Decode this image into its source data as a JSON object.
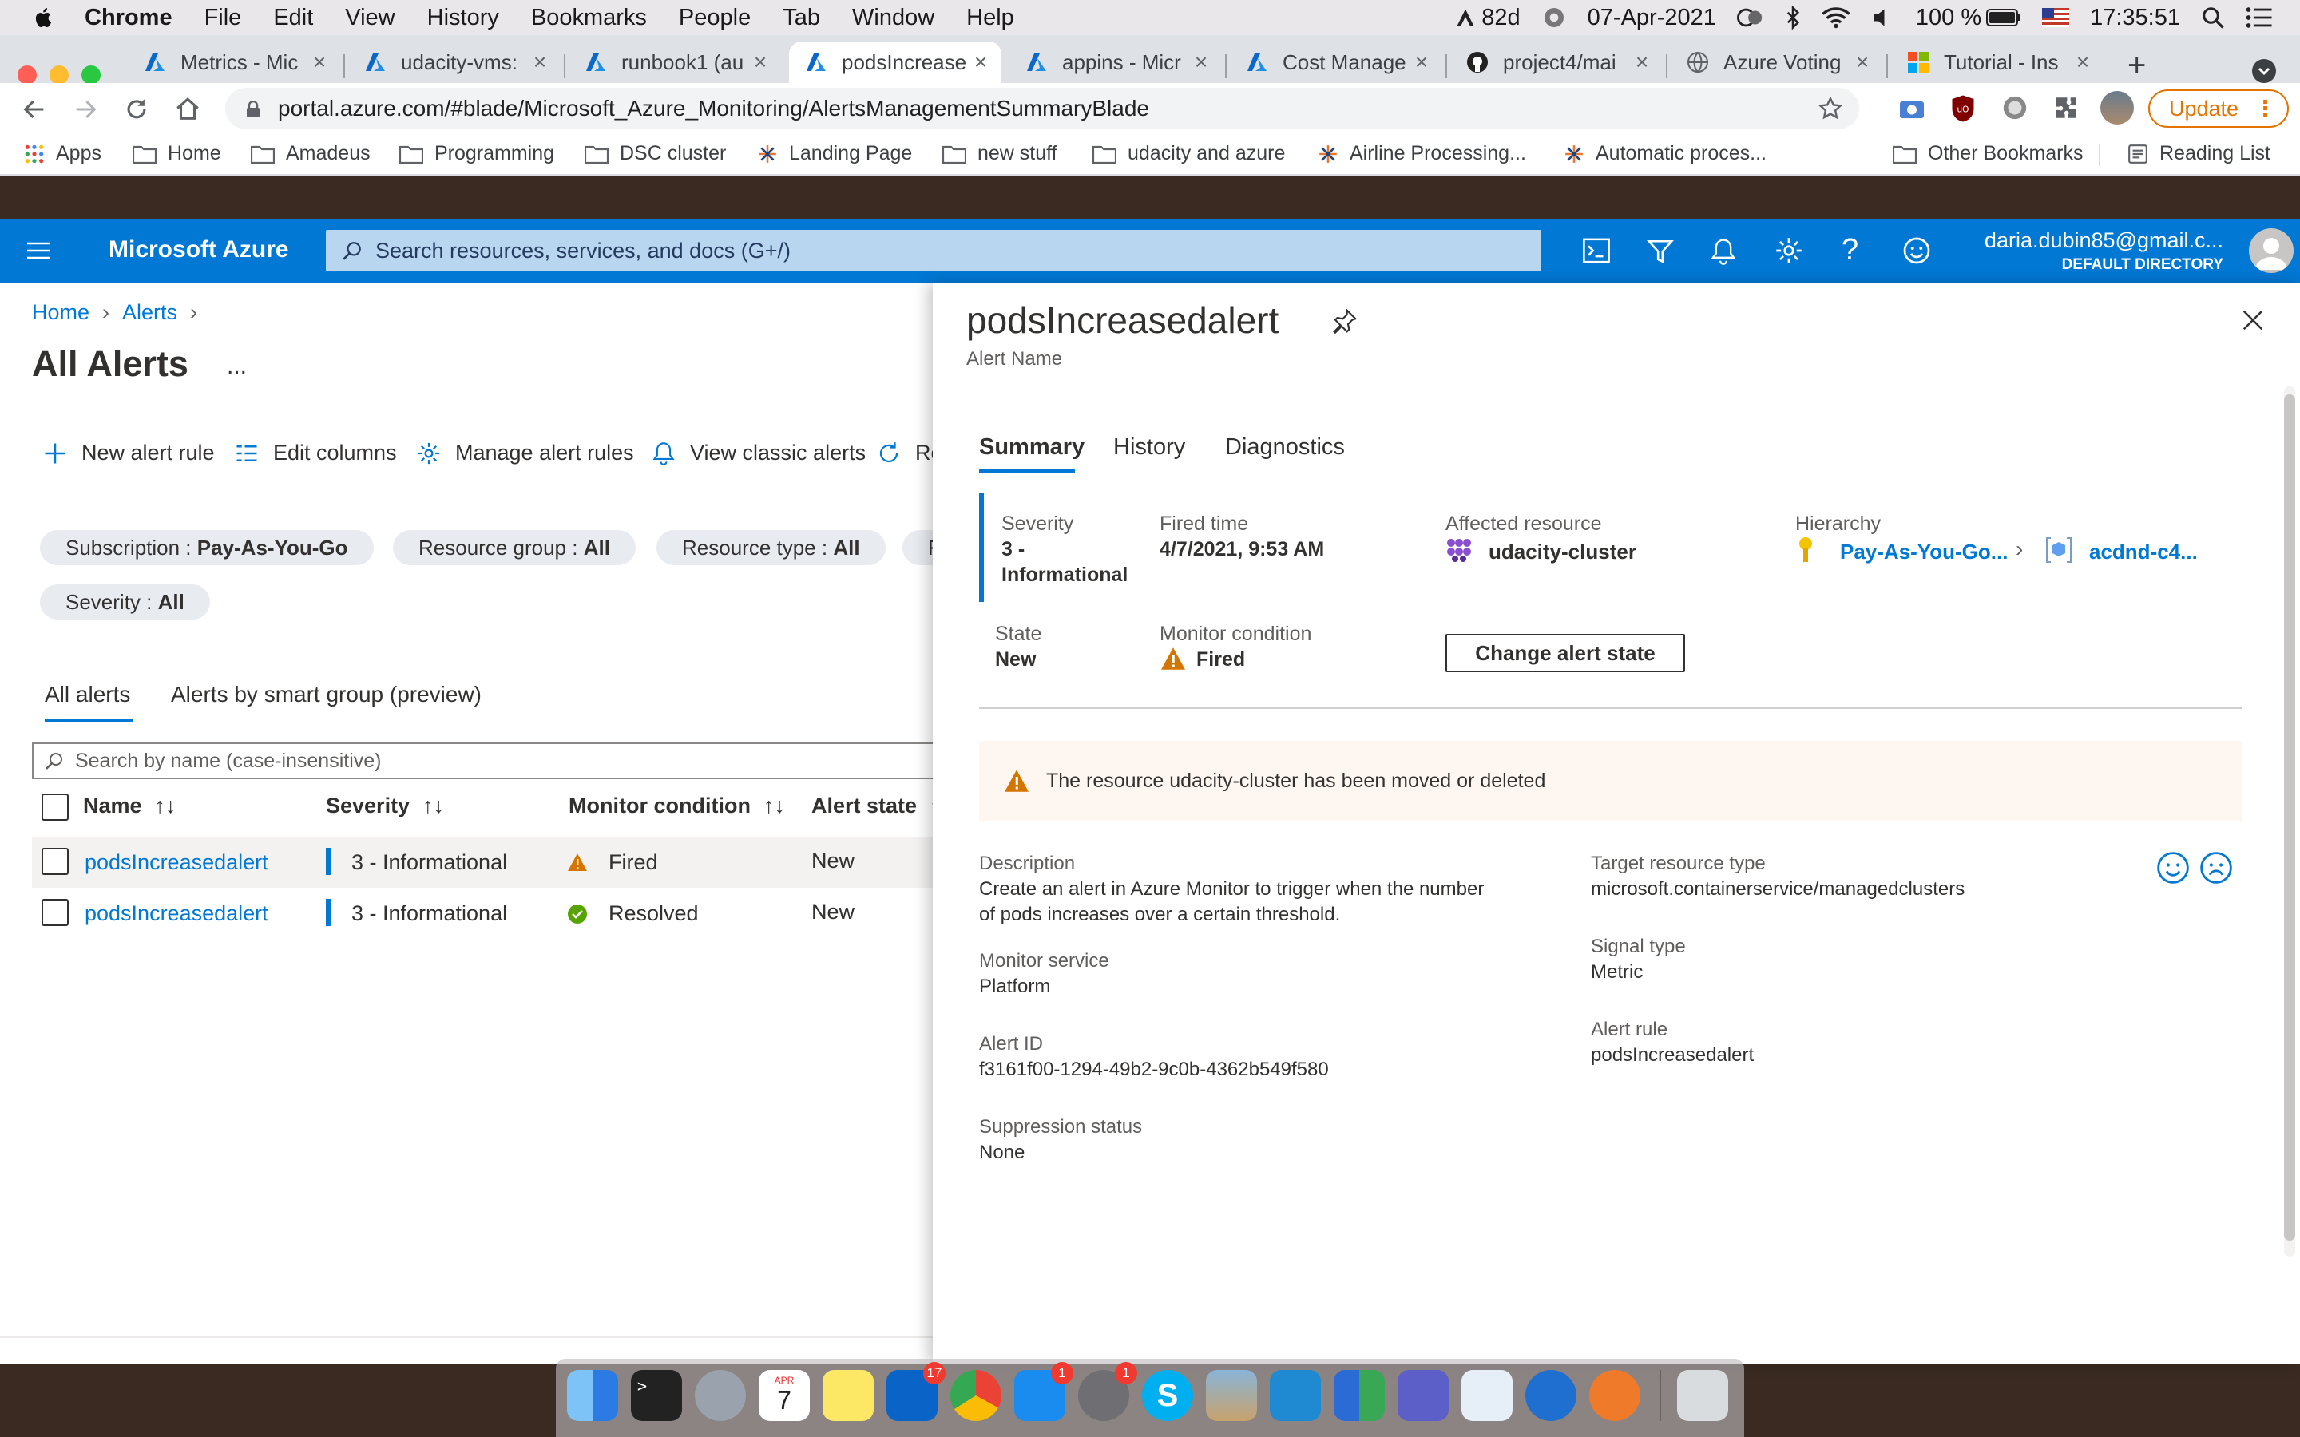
{
  "mac_menu": {
    "app": "Chrome",
    "items": [
      "File",
      "Edit",
      "View",
      "History",
      "Bookmarks",
      "People",
      "Tab",
      "Window",
      "Help"
    ],
    "status": {
      "vpn": "82d",
      "date": "07-Apr-2021",
      "battery": "100 %",
      "time": "17:35:51"
    }
  },
  "tabs": [
    {
      "title": "Metrics - Mic",
      "icon": "azure-icon"
    },
    {
      "title": "udacity-vms:",
      "icon": "azure-icon"
    },
    {
      "title": "runbook1 (au",
      "icon": "azure-icon"
    },
    {
      "title": "podsIncrease",
      "icon": "azure-icon",
      "active": true
    },
    {
      "title": "appins - Micr",
      "icon": "azure-icon"
    },
    {
      "title": "Cost Manage",
      "icon": "azure-icon"
    },
    {
      "title": "project4/mai",
      "icon": "github-icon"
    },
    {
      "title": "Azure Voting",
      "icon": "globe-icon"
    },
    {
      "title": "Tutorial - Ins",
      "icon": "microsoft-icon"
    }
  ],
  "address": {
    "url": "portal.azure.com/#blade/Microsoft_Azure_Monitoring/AlertsManagementSummaryBlade",
    "update_label": "Update"
  },
  "bookmarks": [
    {
      "label": "Apps"
    },
    {
      "label": "Home"
    },
    {
      "label": "Amadeus"
    },
    {
      "label": "Programming"
    },
    {
      "label": "DSC cluster"
    },
    {
      "label": "Landing Page"
    },
    {
      "label": "new stuff"
    },
    {
      "label": "udacity and azure"
    },
    {
      "label": "Airline Processing..."
    },
    {
      "label": "Automatic proces..."
    },
    {
      "label": "Other Bookmarks"
    },
    {
      "label": "Reading List"
    }
  ],
  "azure": {
    "brand": "Microsoft Azure",
    "search_placeholder": "Search resources, services, and docs (G+/)",
    "user_email": "daria.dubin85@gmail.c...",
    "directory": "DEFAULT DIRECTORY"
  },
  "breadcrumb": [
    "Home",
    "Alerts"
  ],
  "page_title": "All Alerts",
  "more": "...",
  "commands": [
    "New alert rule",
    "Edit columns",
    "Manage alert rules",
    "View classic alerts",
    "Re"
  ],
  "filters": {
    "subscription": {
      "label": "Subscription : ",
      "value": "Pay-As-You-Go"
    },
    "resource_group": {
      "label": "Resource group : ",
      "value": "All"
    },
    "resource_type": {
      "label": "Resource type : ",
      "value": "All"
    },
    "cut": "F",
    "severity": {
      "label": "Severity : ",
      "value": "All"
    }
  },
  "view_tabs": [
    "All alerts",
    "Alerts by smart group (preview)"
  ],
  "grid_search_placeholder": "Search by name (case-insensitive)",
  "grid_headers": [
    "Name",
    "Severity",
    "Monitor condition",
    "Alert state"
  ],
  "rows": [
    {
      "name": "podsIncreasedalert",
      "severity": "3 - Informational",
      "condition": "Fired",
      "state": "New"
    },
    {
      "name": "podsIncreasedalert",
      "severity": "3 - Informational",
      "condition": "Resolved",
      "state": "New"
    }
  ],
  "blade": {
    "title": "podsIncreasedalert",
    "subtitle": "Alert Name",
    "tabs": [
      "Summary",
      "History",
      "Diagnostics"
    ],
    "severity_label": "Severity",
    "severity_l1": "3 -",
    "severity_l2": "Informational",
    "fired_label": "Fired time",
    "fired_value": "4/7/2021, 9:53 AM",
    "resource_label": "Affected resource",
    "resource_value": "udacity-cluster",
    "hierarchy_label": "Hierarchy",
    "hierarchy_1": "Pay-As-You-Go...",
    "hierarchy_2": "acdnd-c4...",
    "state_label": "State",
    "state_value": "New",
    "monitor_label": "Monitor condition",
    "monitor_value": "Fired",
    "change_button": "Change alert state",
    "warning": "The resource udacity-cluster has been moved or deleted",
    "desc_label": "Description",
    "desc_l1": "Create an alert in Azure Monitor to trigger when the number",
    "desc_l2": "of pods increases over a certain threshold.",
    "service_label": "Monitor service",
    "service_value": "Platform",
    "alertid_label": "Alert ID",
    "alertid_value": "f3161f00-1294-49b2-9c0b-4362b549f580",
    "suppression_label": "Suppression status",
    "suppression_value": "None",
    "target_label": "Target resource type",
    "target_value": "microsoft.containerservice/managedclusters",
    "signal_label": "Signal type",
    "signal_value": "Metric",
    "rule_label": "Alert rule",
    "rule_value": "podsIncreasedalert"
  },
  "dock": {
    "calendar_month": "APR",
    "calendar_day": "7",
    "outlook_badge": "17",
    "appstore_badge": "1",
    "prefs_badge": "1"
  },
  "colors": {
    "azure_blue": "#0078d4",
    "warning": "#d47500",
    "success": "#57a300",
    "warning_bg": "#fdf6f1"
  }
}
